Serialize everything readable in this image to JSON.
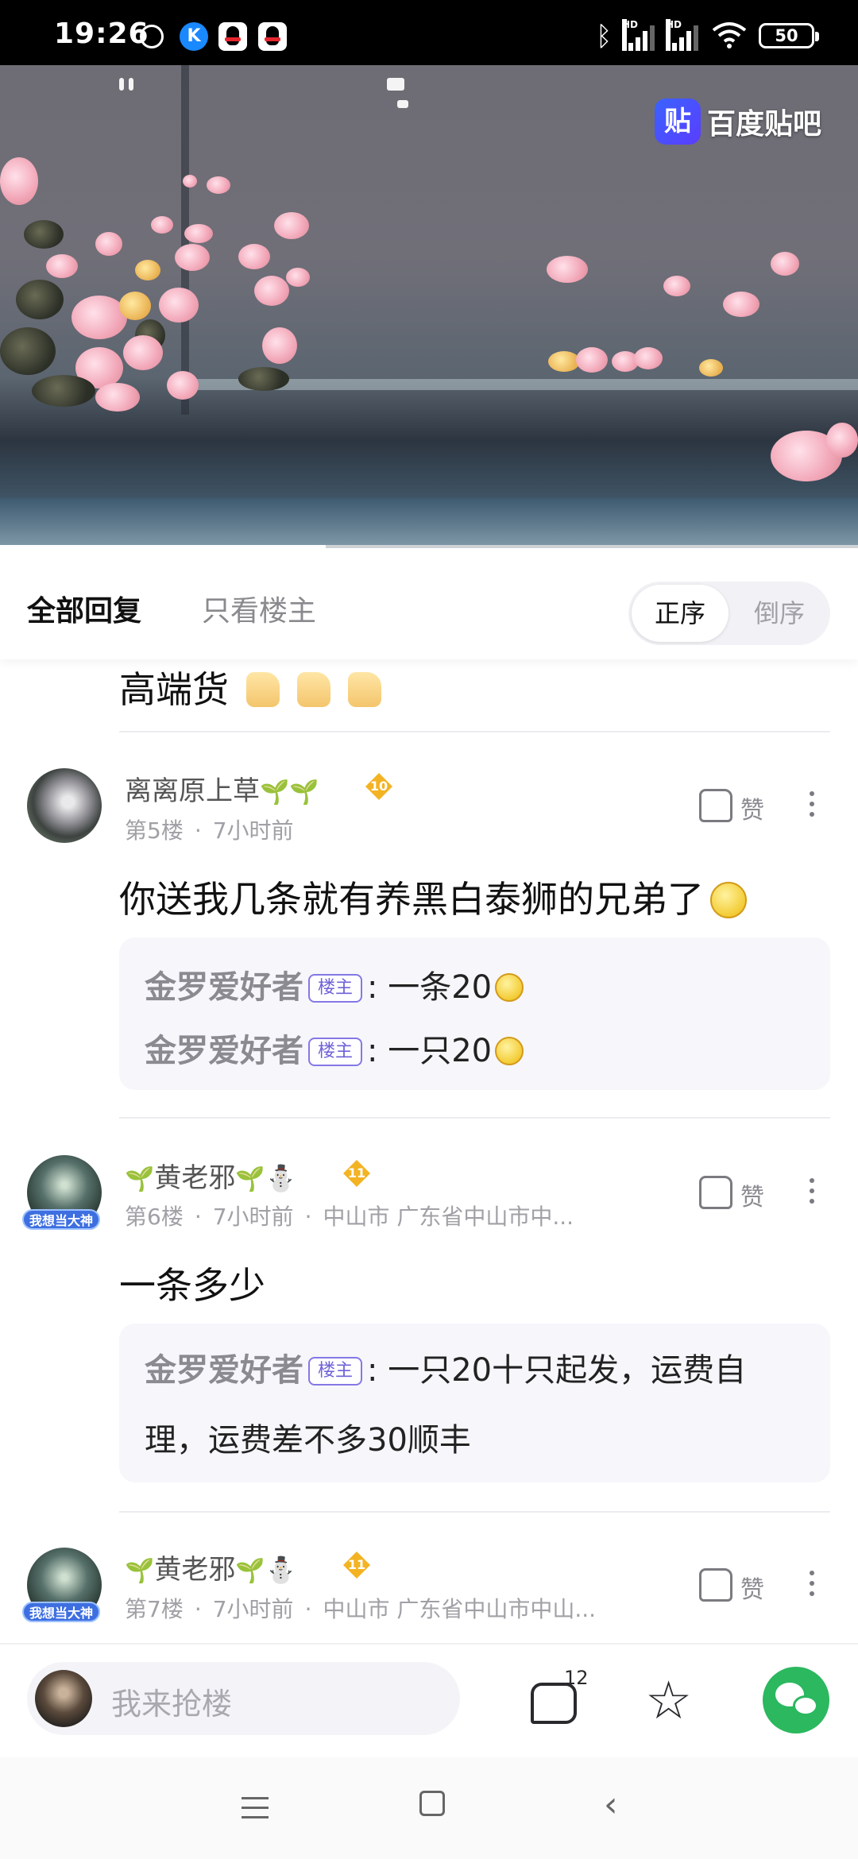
{
  "status_bar": {
    "time": "19:26",
    "battery": "50",
    "signal_label": "HD",
    "icons": [
      "alarm-icon",
      "k-app-icon",
      "qq-icon",
      "qq-icon",
      "bluetooth-icon",
      "signal-icon",
      "signal-icon",
      "wifi-icon",
      "battery-icon"
    ]
  },
  "video": {
    "watermark_logo": "贴",
    "watermark_text": "百度贴吧",
    "progress": 0.38
  },
  "tabs": {
    "all_replies": "全部回复",
    "op_only": "只看楼主",
    "sort_asc": "正序",
    "sort_desc": "倒序"
  },
  "partial_reply": {
    "text": "高端货"
  },
  "replies": [
    {
      "username": "离离原上草",
      "level": "10",
      "floor": "第5楼",
      "time": "7小时前",
      "location": "",
      "like_label": "赞",
      "content": "你送我几条就有养黑白泰狮的兄弟了",
      "sub_replies": [
        {
          "name": "金罗爱好者",
          "tag": "楼主",
          "text": ": 一条20"
        },
        {
          "name": "金罗爱好者",
          "tag": "楼主",
          "text": ": 一只20"
        }
      ]
    },
    {
      "username": "黄老邪",
      "level": "11",
      "badge": "我想当大神",
      "floor": "第6楼",
      "time": "7小时前",
      "location": "中山市 广东省中山市中...",
      "like_label": "赞",
      "content": "一条多少",
      "sub_replies": [
        {
          "name": "金罗爱好者",
          "tag": "楼主",
          "text": ": 一只20十只起发，运费自",
          "text2": "理，运费差不多30顺丰"
        }
      ]
    },
    {
      "username": "黄老邪",
      "level": "11",
      "badge": "我想当大神",
      "floor": "第7楼",
      "time": "7小时前",
      "location": "中山市 广东省中山市中山...",
      "like_label": "赞"
    }
  ],
  "bottom_bar": {
    "placeholder": "我来抢楼",
    "comment_count": "12"
  },
  "colors": {
    "accent_green": "#2bb85f",
    "op_tag": "#6f62d8",
    "level_badge": "#f3b323"
  }
}
